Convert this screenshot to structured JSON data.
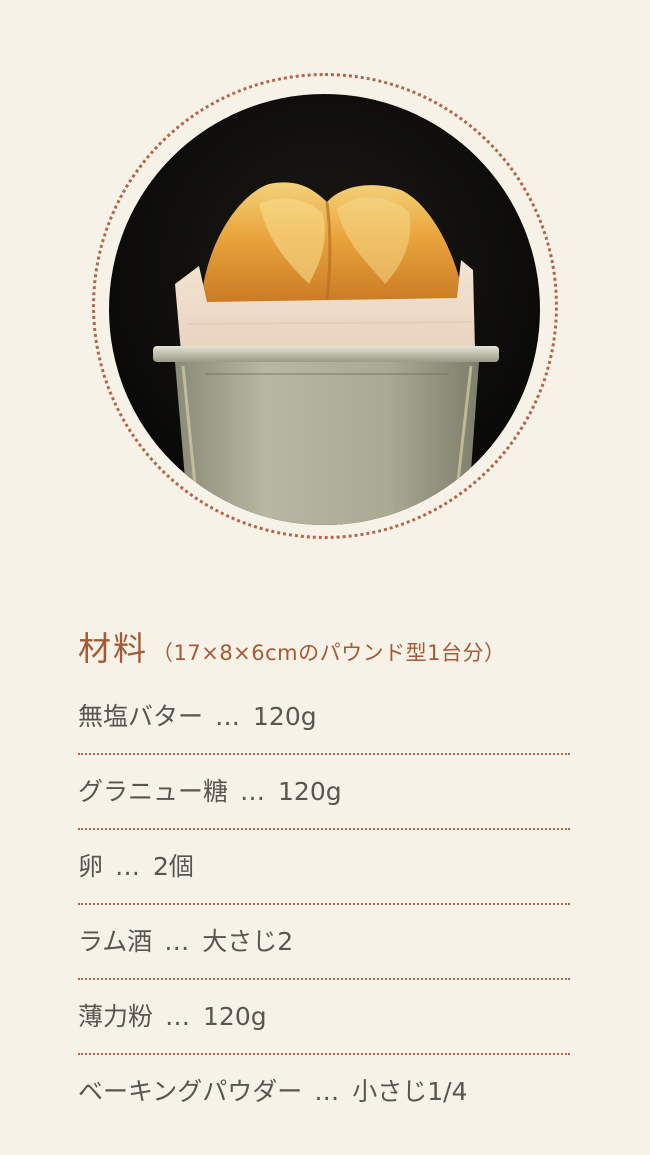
{
  "photo": {
    "subject": "pound-cake-in-loaf-pan-image"
  },
  "ingredients": {
    "title": "材料",
    "subtitle": "（17×8×6cmのパウンド型1台分）",
    "separator": "…",
    "items": [
      {
        "name": "無塩バター",
        "amount": "120g"
      },
      {
        "name": "グラニュー糖",
        "amount": "120g"
      },
      {
        "name": "卵",
        "amount": "2個"
      },
      {
        "name": "ラム酒",
        "amount": "大さじ2"
      },
      {
        "name": "薄力粉",
        "amount": "120g"
      },
      {
        "name": "ベーキングパウダー",
        "amount": "小さじ1/4"
      }
    ]
  },
  "colors": {
    "background": "#f7f2e7",
    "accent": "#a35a38",
    "dotted_border": "#b0674a",
    "body_text": "#5a5550"
  }
}
